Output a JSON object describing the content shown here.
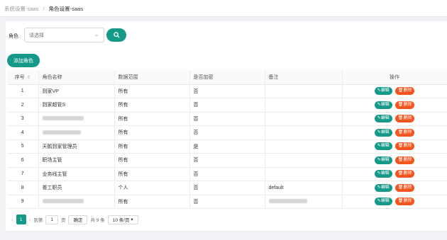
{
  "breadcrumb": {
    "parent": "系统设置-saas",
    "separator": "/",
    "current": "角色设置-saas"
  },
  "filter": {
    "label": "角色",
    "placeholder": "请选择"
  },
  "add_button": "添加角色",
  "table": {
    "headers": [
      "序号",
      "角色名称",
      "数据范围",
      "是否加密",
      "备注",
      "操作"
    ],
    "rows": [
      {
        "index": "1",
        "name": "到家VP",
        "scope": "所有",
        "encrypted": "否",
        "remark": ""
      },
      {
        "index": "2",
        "name": "到家超管S",
        "scope": "所有",
        "encrypted": "否",
        "remark": ""
      },
      {
        "index": "3",
        "name": "",
        "scope": "所有",
        "encrypted": "否",
        "remark": ""
      },
      {
        "index": "4",
        "name": "",
        "scope": "所有",
        "encrypted": "否",
        "remark": ""
      },
      {
        "index": "5",
        "name": "天鹅到家管理员",
        "scope": "所有",
        "encrypted": "是",
        "remark": ""
      },
      {
        "index": "6",
        "name": "职场主管",
        "scope": "所有",
        "encrypted": "否",
        "remark": ""
      },
      {
        "index": "7",
        "name": "业务线主管",
        "scope": "所有",
        "encrypted": "否",
        "remark": ""
      },
      {
        "index": "8",
        "name": "普工职员",
        "scope": "个人",
        "encrypted": "否",
        "remark": "default"
      },
      {
        "index": "9",
        "name": "",
        "scope": "所有",
        "encrypted": "否",
        "remark": ""
      }
    ],
    "edit_label": "编辑",
    "delete_label": "删除"
  },
  "pagination": {
    "current_page": "1",
    "goto_label": "到第",
    "goto_value": "1",
    "page_suffix": "页",
    "confirm_label": "确定",
    "total": "共 9 条",
    "page_size": "10 条/页"
  },
  "colors": {
    "primary": "#159a8a",
    "danger": "#f4551f"
  }
}
